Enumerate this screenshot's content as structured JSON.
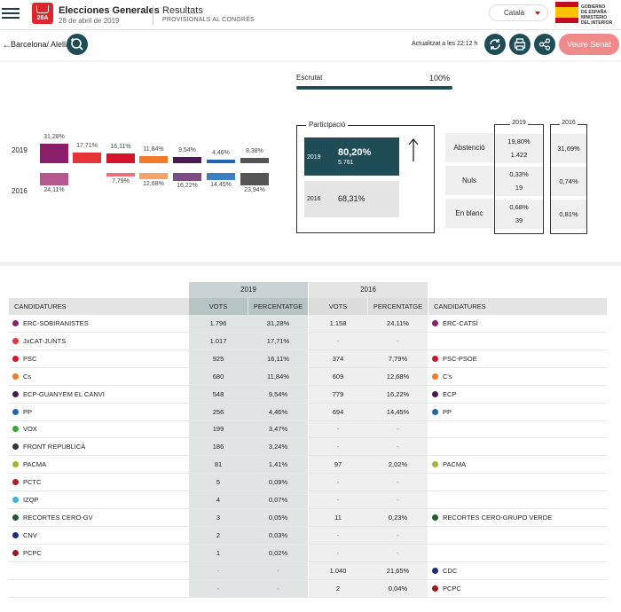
{
  "header": {
    "brand_title": "Elecciones Generales",
    "brand_date": "28 de abril de 2019",
    "logo_text": "28A",
    "results_title": "Resultats",
    "results_subtitle": "PROVISIONALS AL CONGRÉS",
    "language": "Català",
    "gov_text_1": "GOBIERNO",
    "gov_text_2": "DE ESPAÑA",
    "gov_text_3": "MINISTERIO",
    "gov_text_4": "DEL INTERIOR"
  },
  "toolbar": {
    "location": "Barcelona/ Alella",
    "updated": "Actualitzat a les 22:12 h",
    "senat_button": "Veure Senat"
  },
  "summary": {
    "year_2019": "2019",
    "year_2016": "2016",
    "escrutat_label": "Escrutat",
    "escrutat_pct": "100%",
    "escrutat_value": 1.0,
    "participation": {
      "title": "Participació",
      "y2019": {
        "year": "2019",
        "pct": "80,20%",
        "votes": "5.761"
      },
      "y2016": {
        "year": "2016",
        "pct": "68,31%"
      }
    },
    "stats": {
      "col_2019": "2019",
      "col_2016": "2016",
      "rows": [
        {
          "label": "Abstenció",
          "v2019_pct": "19,80%",
          "v2019_votes": "1.422",
          "v2016": "31,69%"
        },
        {
          "label": "Nuls",
          "v2019_pct": "0,33%",
          "v2019_votes": "19",
          "v2016": "0,74%"
        },
        {
          "label": "En blanc",
          "v2019_pct": "0,68%",
          "v2019_votes": "39",
          "v2016": "0,81%"
        }
      ]
    },
    "bars": [
      {
        "color": "#8b1e6b",
        "color16": "#b8568f",
        "p2019": "31,28%",
        "p2016": "24,11%",
        "v2019": 31.28,
        "v2016": 24.11
      },
      {
        "color": "#e3343a",
        "color16": "",
        "p2019": "17,71%",
        "p2016": "",
        "v2019": 17.71,
        "v2016": 0
      },
      {
        "color": "#d3142a",
        "color16": "#e8717a",
        "p2019": "16,11%",
        "p2016": "7,79%",
        "v2019": 16.11,
        "v2016": 7.79
      },
      {
        "color": "#f07a27",
        "color16": "#f5a366",
        "p2019": "11,84%",
        "p2016": "12,68%",
        "v2019": 11.84,
        "v2016": 12.68
      },
      {
        "color": "#4b1a55",
        "color16": "#7b4c86",
        "p2019": "9,54%",
        "p2016": "16,22%",
        "v2019": 9.54,
        "v2016": 16.22
      },
      {
        "color": "#1e68b3",
        "color16": "#3d7fc4",
        "p2019": "4,46%",
        "p2016": "14,45%",
        "v2019": 4.46,
        "v2016": 14.45
      },
      {
        "color": "#555555",
        "color16": "#555555",
        "p2019": "8,38%",
        "p2016": "23,94%",
        "v2019": 8.38,
        "v2016": 23.94
      }
    ]
  },
  "results": {
    "year_2019": "2019",
    "year_2016": "2016",
    "headers": {
      "cand": "CANDIDATURES",
      "votes": "VOTS",
      "pct": "PERCENTATGE",
      "cand16": "CANDIDATURES"
    },
    "rows": [
      {
        "name": "ERC-SOBIRANISTES",
        "color": "#8b1e6b",
        "v19": "1.796",
        "p19": "31,28%",
        "v16": "1.158",
        "p16": "24,11%",
        "name16": "ERC-CATSÍ",
        "color16": "#8b1e6b"
      },
      {
        "name": "JxCAT-JUNTS",
        "color": "#e3343a",
        "v19": "1.017",
        "p19": "17,71%",
        "v16": "-",
        "p16": "-",
        "name16": "",
        "color16": ""
      },
      {
        "name": "PSC",
        "color": "#d3142a",
        "v19": "925",
        "p19": "16,11%",
        "v16": "374",
        "p16": "7,79%",
        "name16": "PSC-PSOE",
        "color16": "#d3142a"
      },
      {
        "name": "Cs",
        "color": "#f07a27",
        "v19": "680",
        "p19": "11,84%",
        "v16": "609",
        "p16": "12,68%",
        "name16": "C's",
        "color16": "#f07a27"
      },
      {
        "name": "ECP-GUANYEM EL CANVI",
        "color": "#4b1a55",
        "v19": "548",
        "p19": "9,54%",
        "v16": "779",
        "p16": "16,22%",
        "name16": "ECP",
        "color16": "#4b1a55"
      },
      {
        "name": "PP",
        "color": "#1e68b3",
        "v19": "256",
        "p19": "4,46%",
        "v16": "694",
        "p16": "14,45%",
        "name16": "PP",
        "color16": "#1e68b3"
      },
      {
        "name": "VOX",
        "color": "#3aa935",
        "v19": "199",
        "p19": "3,47%",
        "v16": "-",
        "p16": "-",
        "name16": "",
        "color16": ""
      },
      {
        "name": "FRONT REPUBLICÀ",
        "color": "#333333",
        "v19": "186",
        "p19": "3,24%",
        "v16": "-",
        "p16": "-",
        "name16": "",
        "color16": ""
      },
      {
        "name": "PACMA",
        "color": "#a6b52a",
        "v19": "81",
        "p19": "1,41%",
        "v16": "97",
        "p16": "2,02%",
        "name16": "PACMA",
        "color16": "#a6b52a"
      },
      {
        "name": "PCTC",
        "color": "#b01e1e",
        "v19": "5",
        "p19": "0,09%",
        "v16": "-",
        "p16": "-",
        "name16": "",
        "color16": ""
      },
      {
        "name": "IZQP",
        "color": "#3ab7d6",
        "v19": "4",
        "p19": "0,07%",
        "v16": "-",
        "p16": "-",
        "name16": "",
        "color16": ""
      },
      {
        "name": "RECORTES CERO-GV",
        "color": "#1d5e2a",
        "v19": "3",
        "p19": "0,05%",
        "v16": "11",
        "p16": "0,23%",
        "name16": "RECORTES CERO-GRUPO VERDE",
        "color16": "#1d5e2a"
      },
      {
        "name": "CNV",
        "color": "#1b2f7a",
        "v19": "2",
        "p19": "0,03%",
        "v16": "-",
        "p16": "-",
        "name16": "",
        "color16": ""
      },
      {
        "name": "PCPC",
        "color": "#9b1b1b",
        "v19": "1",
        "p19": "0,02%",
        "v16": "-",
        "p16": "-",
        "name16": "",
        "color16": ""
      },
      {
        "name": "",
        "color": "",
        "v19": "-",
        "p19": "-",
        "v16": "1.040",
        "p16": "21,65%",
        "name16": "CDC",
        "color16": "#1b2f7a"
      },
      {
        "name": "",
        "color": "",
        "v19": "-",
        "p19": "-",
        "v16": "2",
        "p16": "0,04%",
        "name16": "PCPC",
        "color16": "#9b1b1b"
      }
    ]
  }
}
